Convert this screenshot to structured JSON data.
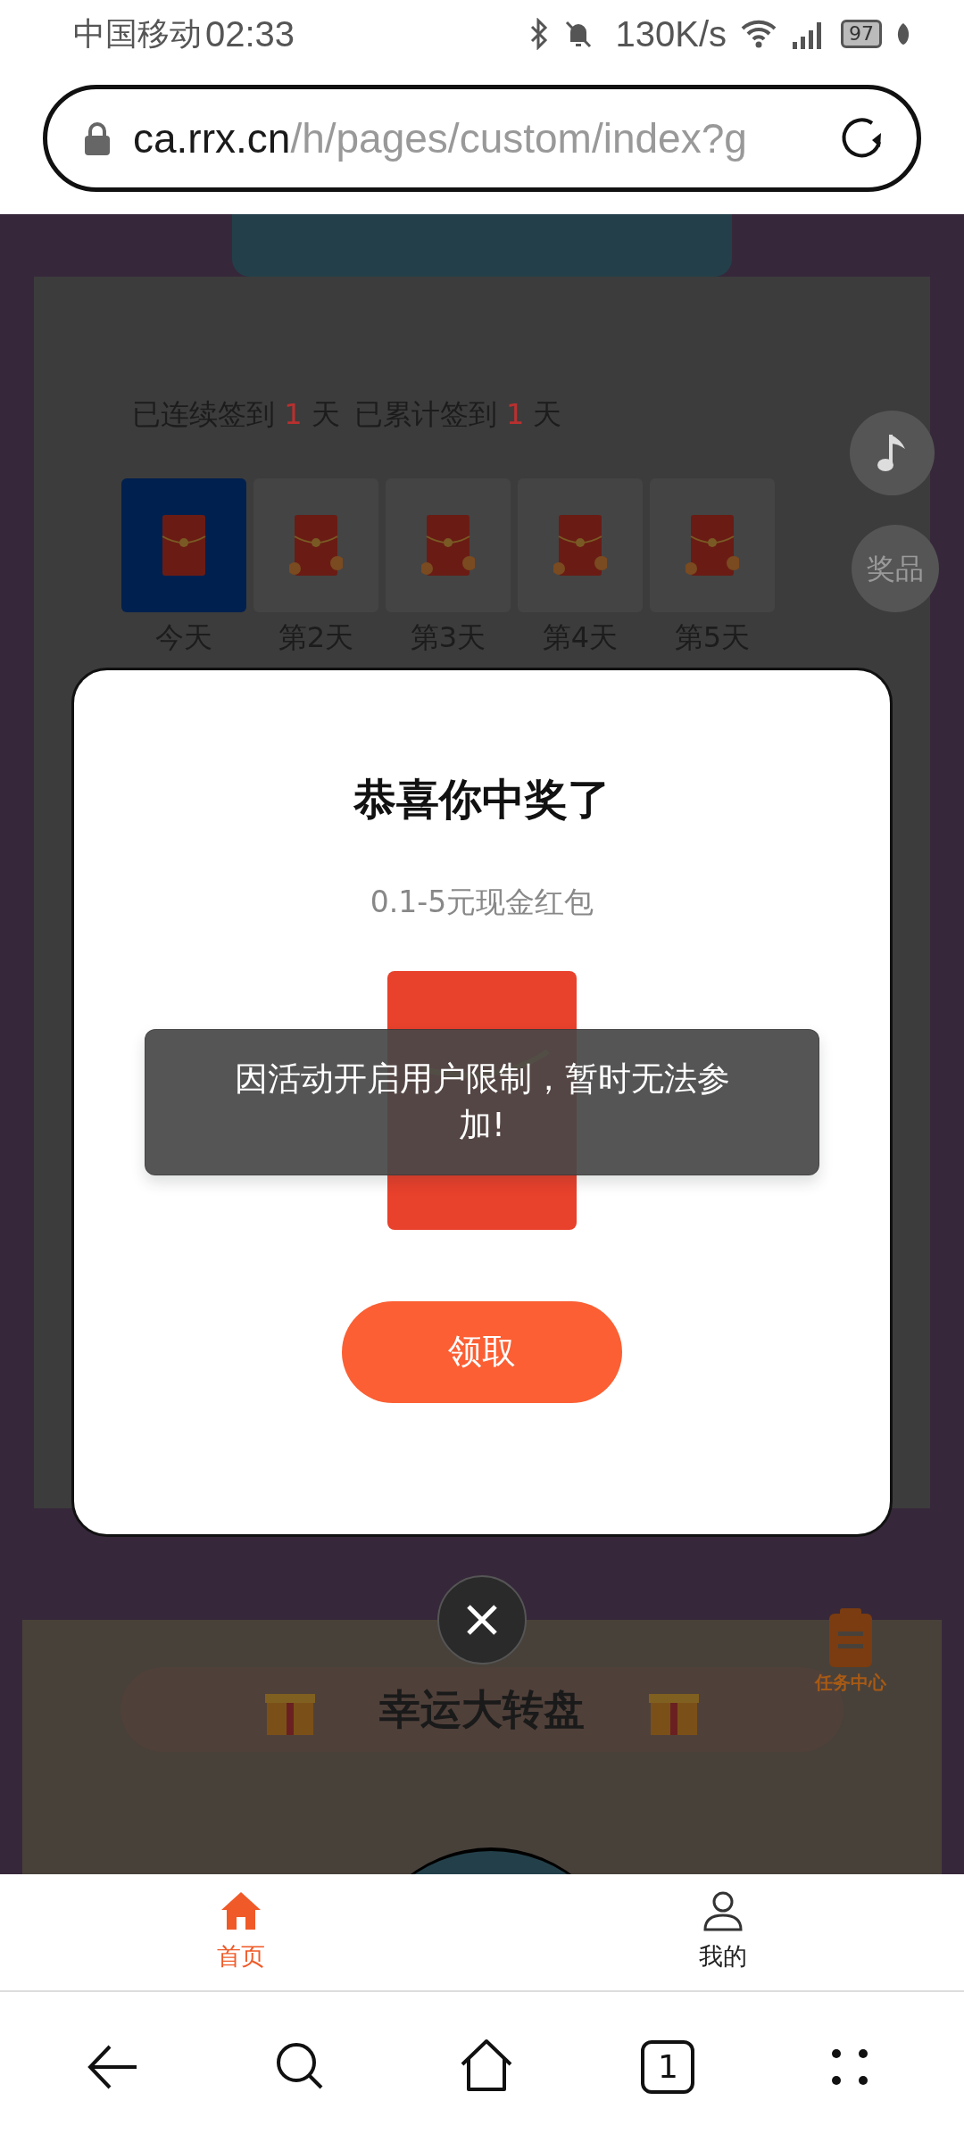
{
  "status_bar": {
    "carrier": "中国移动",
    "time": "02:33",
    "net_speed": "130K/s",
    "battery": "97"
  },
  "address_bar": {
    "domain": "ca.rrx.cn",
    "path": "/h/pages/custom/index?g"
  },
  "page": {
    "streak_label": "已连续签到",
    "streak_count": "1",
    "streak_unit": "天",
    "total_label": "已累计签到",
    "total_count": "1",
    "total_unit": "天",
    "days": [
      {
        "label": "今天",
        "selected": true
      },
      {
        "label": "第2天",
        "selected": false
      },
      {
        "label": "第3天",
        "selected": false
      },
      {
        "label": "第4天",
        "selected": false
      },
      {
        "label": "第5天",
        "selected": false
      }
    ],
    "prize_button": "奖品",
    "task_center": "任务中心",
    "wheel_title": "幸运大转盘"
  },
  "dialog": {
    "title": "恭喜你中奖了",
    "prize": "0.1-5元现金红包",
    "claim_button": "领取"
  },
  "toast": "因活动开启用户限制，暂时无法参加!",
  "tab_bar": [
    {
      "label": "首页",
      "selected": true
    },
    {
      "label": "我的",
      "selected": false
    }
  ],
  "browser_toolbar": {
    "tab_count": "1"
  }
}
